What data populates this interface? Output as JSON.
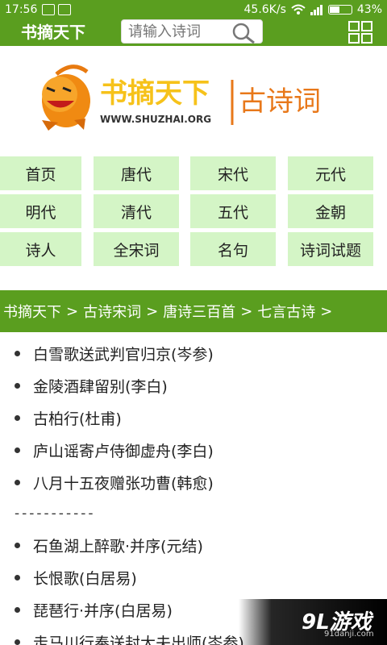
{
  "status": {
    "time": "17:56",
    "speed": "45.6K/s",
    "battery": "43%"
  },
  "header": {
    "brand": "书摘天下",
    "search_placeholder": "请输入诗词"
  },
  "logo": {
    "title": "书摘天下",
    "subtitle": "古诗词",
    "url": "WWW.SHUZHAI.ORG"
  },
  "nav": [
    [
      "首页",
      "唐代",
      "宋代",
      "元代"
    ],
    [
      "明代",
      "清代",
      "五代",
      "金朝"
    ],
    [
      "诗人",
      "全宋词",
      "名句",
      "诗词试题"
    ]
  ],
  "breadcrumb": [
    "书摘天下",
    "古诗宋词",
    "唐诗三百首",
    "七言古诗"
  ],
  "poems": [
    "白雪歌送武判官归京(岑参)",
    "金陵酒肆留别(李白)",
    "古柏行(杜甫)",
    "庐山谣寄卢侍御虚舟(李白)",
    "八月十五夜赠张功曹(韩愈)",
    "-----------",
    "石鱼湖上醉歌·并序(元结)",
    "长恨歌(白居易)",
    "琵琶行·并序(白居易)",
    "走马川行奉送封大夫出师(岑参)"
  ],
  "watermark": {
    "logo": "9L游戏",
    "site": "91danji.com"
  }
}
